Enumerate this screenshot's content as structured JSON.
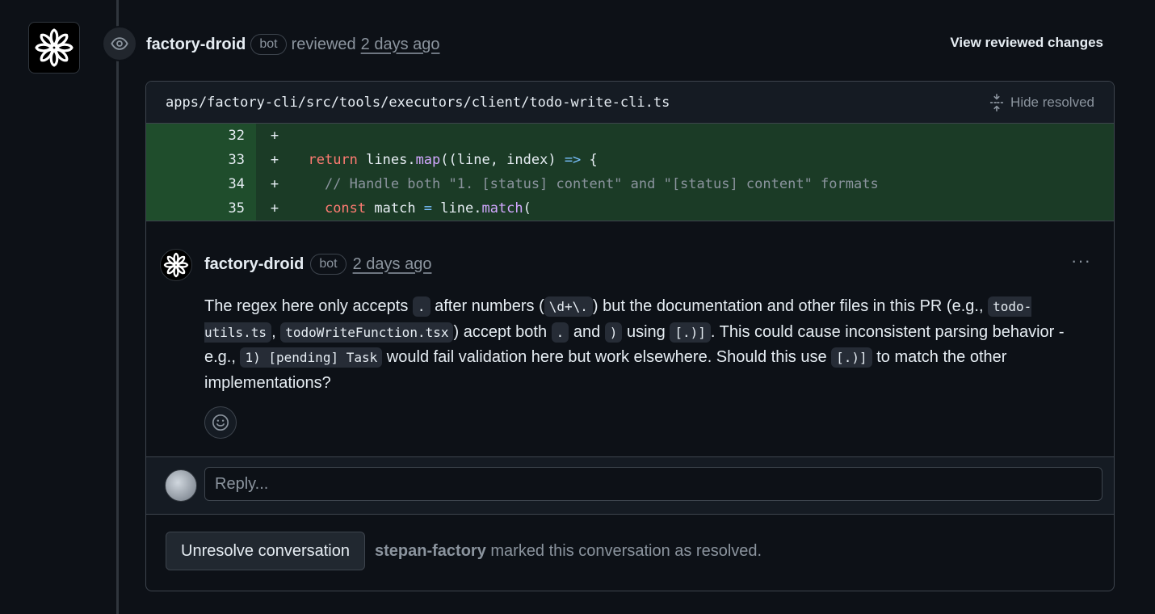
{
  "review": {
    "author": "factory-droid",
    "badge": "bot",
    "action": "reviewed",
    "time": "2 days ago",
    "view_changes_label": "View reviewed changes"
  },
  "file": {
    "path": "apps/factory-cli/src/tools/executors/client/todo-write-cli.ts",
    "hide_resolved_label": "Hide resolved"
  },
  "diff": {
    "lines": [
      {
        "num": "32",
        "sign": "+"
      },
      {
        "num": "33",
        "sign": "+"
      },
      {
        "num": "34",
        "sign": "+"
      },
      {
        "num": "35",
        "sign": "+"
      }
    ],
    "code": {
      "l33_kw": "return",
      "l33_a": " lines.",
      "l33_fn": "map",
      "l33_b": "((line, index) ",
      "l33_op": "=>",
      "l33_c": " {",
      "l34_comment": "// Handle both \"1. [status] content\" and \"[status] content\" formats",
      "l35_kw": "const",
      "l35_a": " match ",
      "l35_op": "=",
      "l35_b": " line.",
      "l35_fn": "match",
      "l35_c": "("
    }
  },
  "comment": {
    "author": "factory-droid",
    "badge": "bot",
    "time": "2 days ago",
    "more": "···",
    "body": {
      "t1": "The regex here only accepts ",
      "c1": ".",
      "t2": " after numbers (",
      "c2": "\\d+\\.",
      "t3": ") but the documentation and other files in this PR (e.g., ",
      "c3": "todo-utils.ts",
      "t4": ", ",
      "c4": "todoWriteFunction.tsx",
      "t5": ") accept both ",
      "c5": ".",
      "t6": " and ",
      "c6": ")",
      "t7": " using ",
      "c7": "[.)]",
      "t8": ". This could cause inconsistent parsing behavior - e.g., ",
      "c8": "1) [pending] Task",
      "t9": " would fail validation here but work elsewhere. Should this use ",
      "c9": "[.)]",
      "t10": " to match the other implementations?"
    }
  },
  "reply": {
    "placeholder": "Reply..."
  },
  "resolution": {
    "button_label": "Unresolve conversation",
    "user": "stepan-factory",
    "text": " marked this conversation as resolved."
  },
  "icons": {
    "logo": "factory-logo-icon",
    "eye": "eye-icon",
    "fold": "unfold-icon",
    "smiley": "smiley-icon",
    "kebab": "kebab-horizontal-icon"
  }
}
